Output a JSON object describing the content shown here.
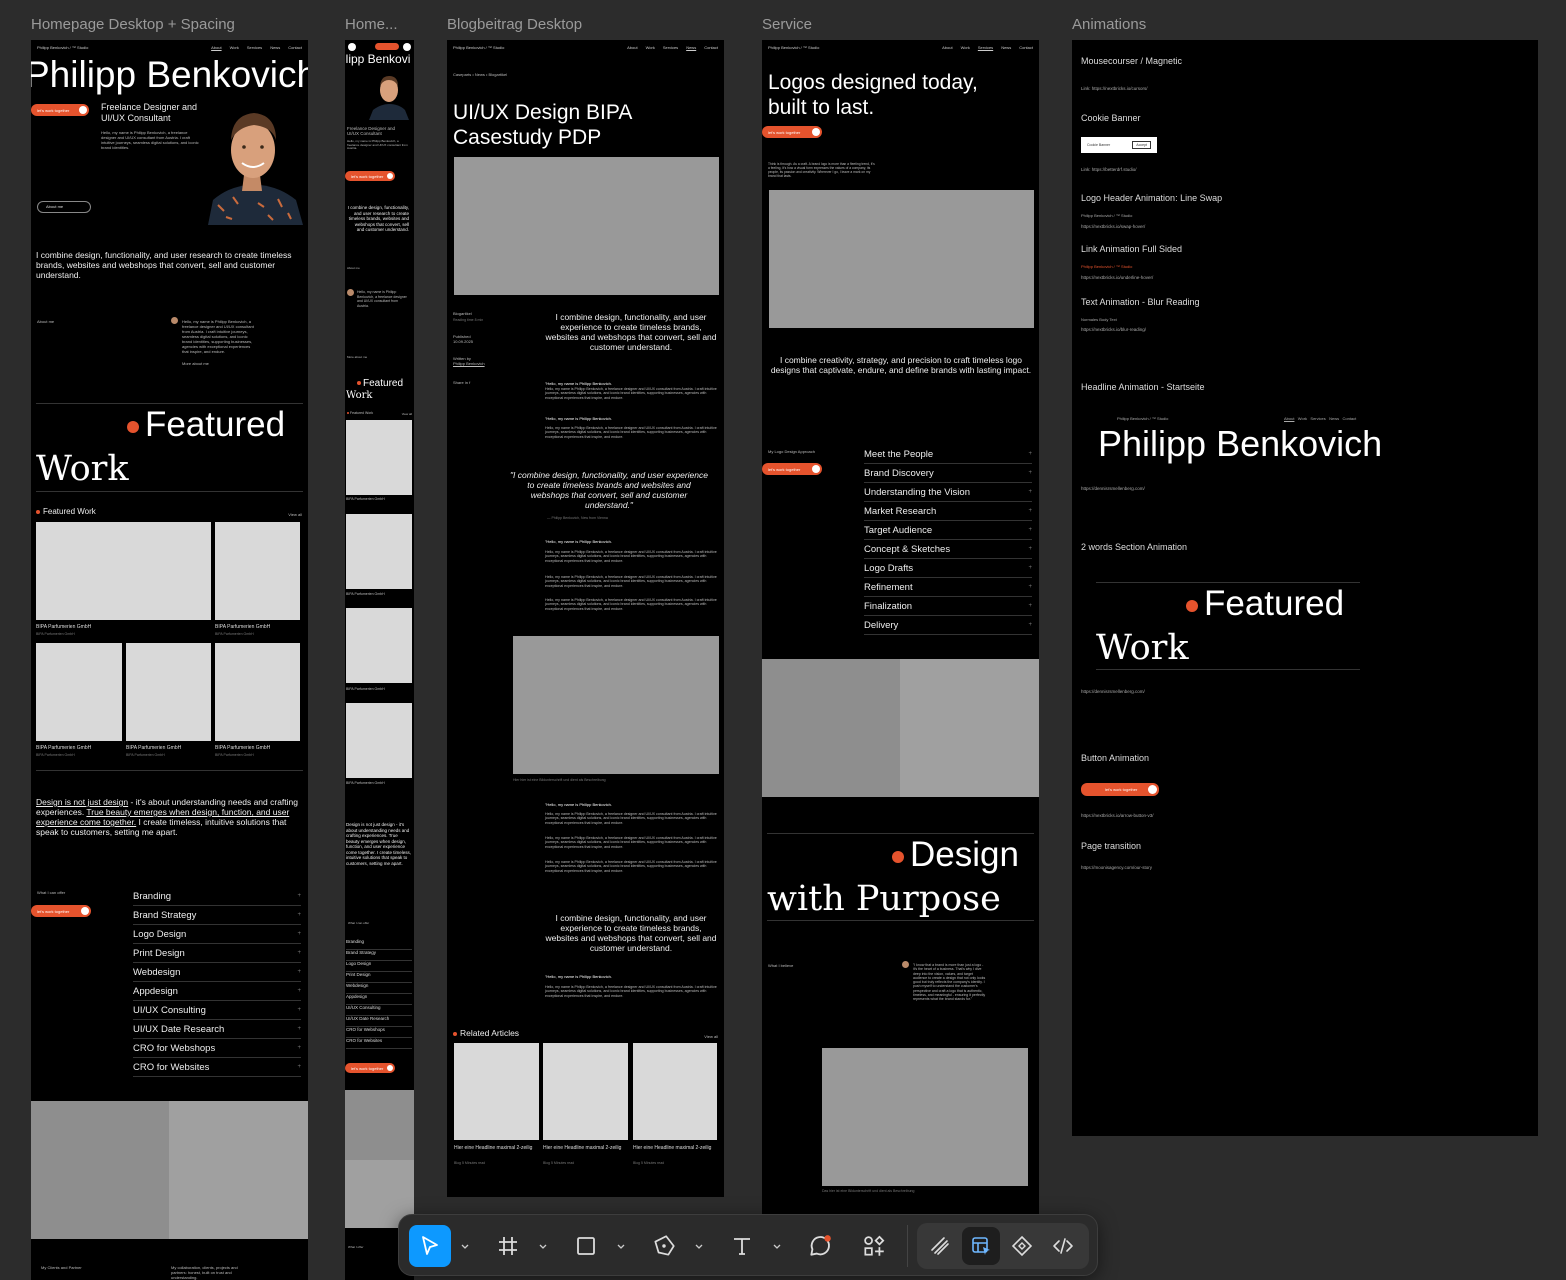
{
  "frames": {
    "homepage_label": "Homepage Desktop + Spacing",
    "home_mobile_label": "Home...",
    "blog_label": "Blogbeitrag Desktop",
    "service_label": "Service",
    "animations_label": "Animations"
  },
  "homepage": {
    "nav_brand": "Philipp Benkovich / ™ Studio",
    "nav_links": [
      "About",
      "Work",
      "Services",
      "News",
      "Contact"
    ],
    "hero_name": "Philipp Benkovich",
    "cta": "let's work together",
    "subtitle": "Freelance Designer and UI/UX Consultant",
    "intro_small": "Hello, my name is Philipp Benkovich, a freelance designer and UI/UX consultant from Austria. I craft intuitive journeys, seamless digital solutions, and iconic brand identities.",
    "about_btn": "About me",
    "statement": "I combine design, functionality, and user research to create timeless brands, websites and webshops that convert, sell and customer understand.",
    "about_label": "About me",
    "about_text": "Hello, my name is Philipp Benkovich, a freelance designer and UI/UX consultant from Austria. I craft intuitive journeys, seamless digital solutions, and iconic brand identities, supporting businesses, agencies with exceptional experiences that inspire, and endure.",
    "more_about": "More about me",
    "featured_word": "Featured",
    "work_word": "Work",
    "featured_label": "Featured Work",
    "view_all": "View all",
    "card_title": "BIPA Parfumerien GmbH",
    "card_sub": "BIPA Parfumerien GmbH",
    "design_p1": "Design is not just design",
    "design_p2": " - it's about understanding needs and crafting experiences. ",
    "design_p3": "True beauty emerges when design, function, and user experience come together.",
    "design_p4": " I create timeless, intuitive solutions that speak to customers, setting me apart.",
    "offer_label": "What I can offer",
    "services": [
      "Branding",
      "Brand Strategy",
      "Logo Design",
      "Print Design",
      "Webdesign",
      "Appdesign",
      "UI/UX Consulting",
      "UI/UX Date Research",
      "CRO for Webshops",
      "CRO for Websites"
    ],
    "clients_label": "My Clients and Partner",
    "clients_text": "My collaboration, clients, projects and partners: honest, built on trust and understanding."
  },
  "mobile": {
    "name": "ilipp Benkovi",
    "subtitle": "Freelance Designer and UI/UX Consultant",
    "cta": "let's work together",
    "statement": "I combine design, functionality, and user research to create timeless brands, websites and webshops that convert, sell and customer understand.",
    "about_label": "About me",
    "about_text": "Hello, my name is Philipp Benkovich, a freelance designer and UI/UX consultant from Austria.",
    "more_about": "More about me",
    "featured_word": "Featured",
    "work_word": "Work",
    "featured_label": "Featured Work",
    "view_all": "View all",
    "card_title": "BIPA Parfumerien GmbH",
    "design_text": "Design is not just design - it's about understanding needs and crafting experiences. True beauty emerges when design, function, and user experience come together. I create timeless, intuitive solutions that speak to customers, setting me apart.",
    "offer_label": "What I can offer",
    "services": [
      "Branding",
      "Brand Strategy",
      "Logo Design",
      "Print Design",
      "Webdesign",
      "Appdesign",
      "UI/UX Consulting",
      "UI/UX Date Research",
      "CRO for Webshops",
      "CRO for Websites"
    ],
    "what_label": "What I offer"
  },
  "blog": {
    "nav_brand": "Philipp Benkovich / ™ Studio",
    "nav_links": [
      "About",
      "Work",
      "Services",
      "News",
      "Contact"
    ],
    "breadcrumb": "Caseparts  •  News  •  Blogartikel",
    "title": "UI/UX Design BIPA Casestudy PDP",
    "meta_category": "Blogartikel",
    "meta_reading": "Reading time 8 min",
    "meta_published": "Published",
    "meta_date": "10.09.2025",
    "meta_written": "Written by",
    "meta_author": "Philipp Benkovich",
    "meta_share": "Share",
    "lead": "I combine design, functionality, and user experience to create timeless brands, websites and webshops that convert, sell and customer understand.",
    "para_head": "\"Hello, my name is Philipp Benkovich.",
    "para_body": "Hello, my name is Philipp Benkovich, a freelance designer and UI/UX consultant from Austria. I craft intuitive journeys, seamless digital solutions, and iconic brand identities, supporting businesses, agencies with exceptional experiences that inspire, and endure.",
    "quote": "\"I combine design, functionality, and user experience to create timeless brands and websites and webshops that convert, sell and customer understand.\"",
    "quote_author": "— Philipp Benkovich, New from Vienna",
    "image_caption": "Hier hier ist eine Bildunterschrift und dient als Beschreibung",
    "related": "Related Articles",
    "view_all": "View all",
    "article_title": "Hier eine Headline maximal 2-zeilig",
    "article_meta": "Blog  5 Minutes read"
  },
  "service": {
    "nav_brand": "Philipp Benkovich / ™ Studio",
    "nav_links": [
      "About",
      "Work",
      "Services",
      "News",
      "Contact"
    ],
    "headline": "Logos designed today, built to last.",
    "cta": "let's work together",
    "small_text": "Think is through. As a craft. A brand logo is more than a fleeting trend, it's a feeling, it's how a visual form expresses the values of a company, its people, its passion and creativity. Wherever I go, I leave a mark on my brand that lasts.",
    "statement": "I combine creativity, strategy, and precision to craft timeless logo designs that captivate, endure, and define brands with lasting impact.",
    "approach_label": "My Logo Design Approach",
    "steps": [
      "Meet the People",
      "Brand Discovery",
      "Understanding the Vision",
      "Market Research",
      "Target Audience",
      "Concept & Sketches",
      "Logo Drafts",
      "Refinement",
      "Finalization",
      "Delivery"
    ],
    "design_word": "Design",
    "purpose_word": "with Purpose",
    "believe_label": "What I believe",
    "believe_text": "\"I know that a brand is more than just a logo - it's the heart of a business. That's why I dive deep into the vision, values, and target audience to create a design that not only looks good but truly reflects the company's identity. I push myself to understand the customer's perspective and craft a logo that is authentic, timeless, and meaningful - ensuring it perfectly represents what the brand stands for.\"",
    "caption": "Das hier ist eine Bildunterschrift und dient als Beschreibung"
  },
  "animations": {
    "items": [
      {
        "title": "Mousecourser / Magnetic",
        "link": "Link: https://nextbricks.io/cursors/"
      },
      {
        "title": "Cookie Banner",
        "link": "Link: https://betterdrf.studio/"
      },
      {
        "title": "Logo Header Animation: Line Swap",
        "link": "https://nextbricks.io/swap-hover/"
      },
      {
        "title": "Link Animation Full Sided",
        "link": "https://nextbricks.io/underline-hover/"
      },
      {
        "title": "Text Animation - Blur Reading",
        "link": "https://nextbricks.io/blur-reading/"
      },
      {
        "title": "Headline Animation - Startseite",
        "link": "https://dennisrsmellenberg.com/"
      },
      {
        "title": "2 words Section Animation",
        "link": "https://dennisrsmellenberg.com/"
      },
      {
        "title": "Button Animation",
        "link": "https://nextbricks.io/arrow-button-v3/"
      },
      {
        "title": "Page transition",
        "link": "https://moonisagency.com/our-story"
      }
    ],
    "logo_small": "Philipp Benkovich / ™ Studio",
    "link_orange": "Philipp Benkovich / ™ Studio",
    "blur_small": "Normales Body Text",
    "cookie_text": "Cookie Banner",
    "cookie_accept": "Accept",
    "headline": "Philipp Benkovich",
    "featured_word": "Featured",
    "work_word": "Work",
    "button": "let's work together",
    "nav_links": [
      "About",
      "Work",
      "Services",
      "News",
      "Contact"
    ]
  },
  "toolbar": {
    "tools": [
      "move-tool",
      "frame-tool",
      "rectangle-tool",
      "pen-tool",
      "text-tool",
      "comment-tool",
      "assets-tool"
    ],
    "modes": [
      "draw-mode",
      "design-mode",
      "prototype-mode",
      "dev-mode"
    ]
  },
  "colors": {
    "accent": "#e5532d",
    "canvas": "#2c2c2c",
    "active_tool": "#0d99ff",
    "placeholder_light": "#d9d9d9",
    "placeholder_dark": "#999999"
  }
}
